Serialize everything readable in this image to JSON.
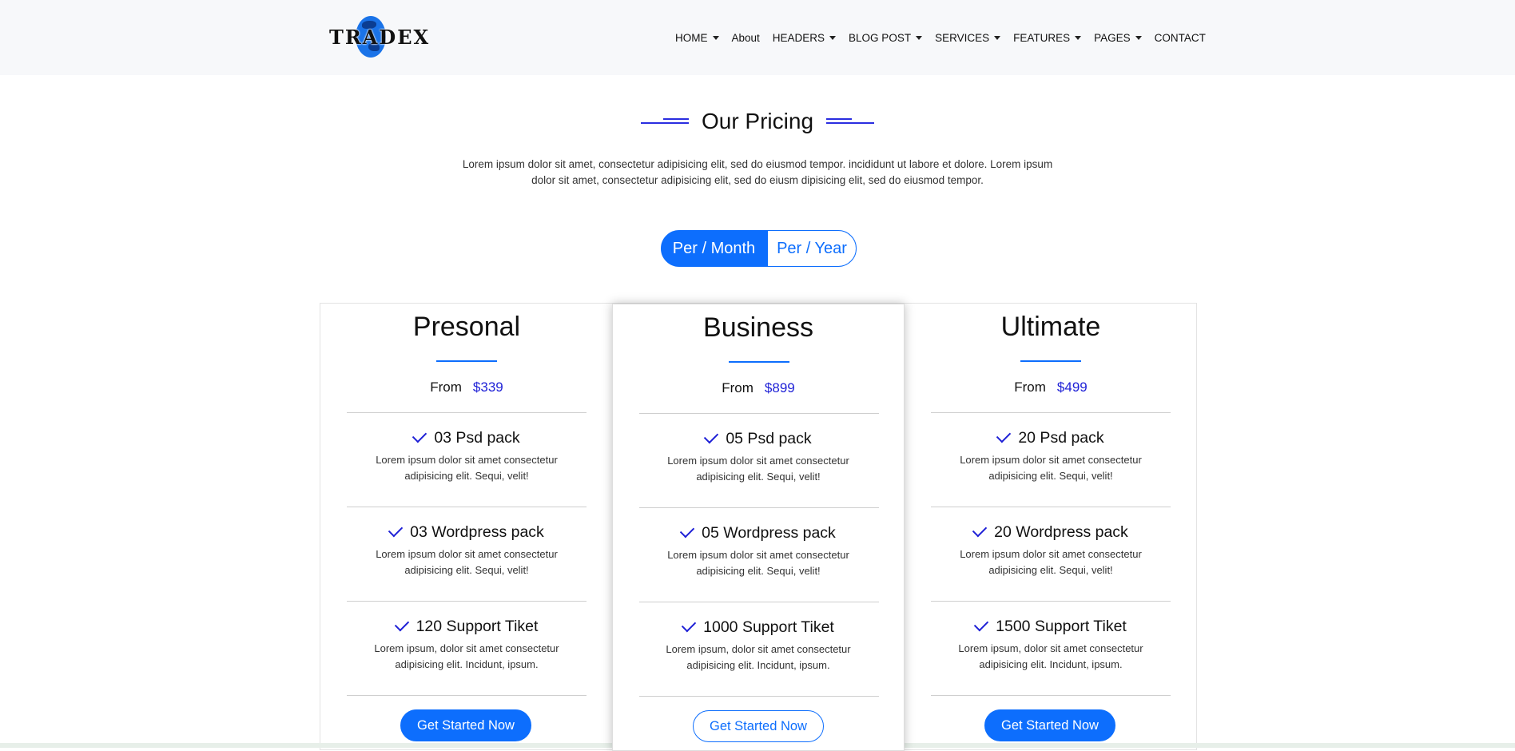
{
  "brand": {
    "logo_text": "TRADEX"
  },
  "nav": [
    {
      "label": "HOME",
      "dropdown": true
    },
    {
      "label": "About",
      "dropdown": false
    },
    {
      "label": "HEADERS",
      "dropdown": true
    },
    {
      "label": "BLOG POST",
      "dropdown": true
    },
    {
      "label": "SERVICES",
      "dropdown": true
    },
    {
      "label": "FEATURES",
      "dropdown": true
    },
    {
      "label": "PAGES",
      "dropdown": true
    },
    {
      "label": "CONTACT",
      "dropdown": false
    }
  ],
  "section": {
    "title": "Our Pricing",
    "intro_line1": "Lorem ipsum dolor sit amet, consectetur adipisicing elit, sed do eiusmod tempor. incididunt ut labore et dolore. Lorem ipsum",
    "intro_line2": "dolor sit amet, consectetur adipisicing elit, sed do eiusm dipisicing elit, sed do eiusmod tempor."
  },
  "toggle": {
    "month": "Per / Month",
    "year": "Per / Year",
    "active": "month"
  },
  "colors": {
    "accent": "#0d6efd",
    "price": "#1d1fd6",
    "header_bg": "#f7f8fa"
  },
  "plans": [
    {
      "name": "Presonal",
      "from": "From",
      "price": "$339",
      "features": [
        {
          "title": "03 Psd pack",
          "desc1": "Lorem ipsum dolor sit amet consectetur",
          "desc2": "adipisicing elit. Sequi, velit!"
        },
        {
          "title": "03 Wordpress pack",
          "desc1": "Lorem ipsum dolor sit amet consectetur",
          "desc2": "adipisicing elit. Sequi, velit!"
        },
        {
          "title": "120 Support Tiket",
          "desc1": "Lorem ipsum, dolor sit amet consectetur",
          "desc2": "adipisicing elit. Incidunt, ipsum."
        }
      ],
      "cta": "Get Started Now",
      "cta_style": "solid"
    },
    {
      "name": "Business",
      "from": "From",
      "price": "$899",
      "features": [
        {
          "title": "05 Psd pack",
          "desc1": "Lorem ipsum dolor sit amet consectetur",
          "desc2": "adipisicing elit. Sequi, velit!"
        },
        {
          "title": "05 Wordpress pack",
          "desc1": "Lorem ipsum dolor sit amet consectetur",
          "desc2": "adipisicing elit. Sequi, velit!"
        },
        {
          "title": "1000 Support Tiket",
          "desc1": "Lorem ipsum, dolor sit amet consectetur",
          "desc2": "adipisicing elit. Incidunt, ipsum."
        }
      ],
      "cta": "Get Started Now",
      "cta_style": "outline"
    },
    {
      "name": "Ultimate",
      "from": "From",
      "price": "$499",
      "features": [
        {
          "title": "20 Psd pack",
          "desc1": "Lorem ipsum dolor sit amet consectetur",
          "desc2": "adipisicing elit. Sequi, velit!"
        },
        {
          "title": "20 Wordpress pack",
          "desc1": "Lorem ipsum dolor sit amet consectetur",
          "desc2": "adipisicing elit. Sequi, velit!"
        },
        {
          "title": "1500 Support Tiket",
          "desc1": "Lorem ipsum, dolor sit amet consectetur",
          "desc2": "adipisicing elit. Incidunt, ipsum."
        }
      ],
      "cta": "Get Started Now",
      "cta_style": "solid"
    }
  ]
}
